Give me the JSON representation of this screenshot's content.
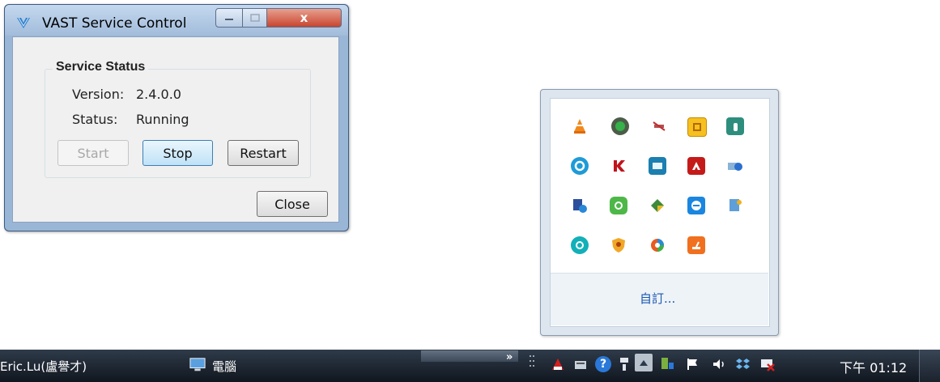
{
  "window": {
    "title": "VAST Service Control",
    "group_title": "Service Status",
    "version_label": "Version:",
    "version_value": "2.4.0.0",
    "status_label": "Status:",
    "status_value": "Running",
    "start_label": "Start",
    "stop_label": "Stop",
    "restart_label": "Restart",
    "close_label": "Close",
    "close_glyph": "x"
  },
  "tray_popup": {
    "customize_label": "自訂..."
  },
  "taskbar": {
    "user_label": "Eric.Lu(盧譽才)",
    "computer_label": "電腦",
    "chevron": "»",
    "clock": "下午 01:12"
  }
}
